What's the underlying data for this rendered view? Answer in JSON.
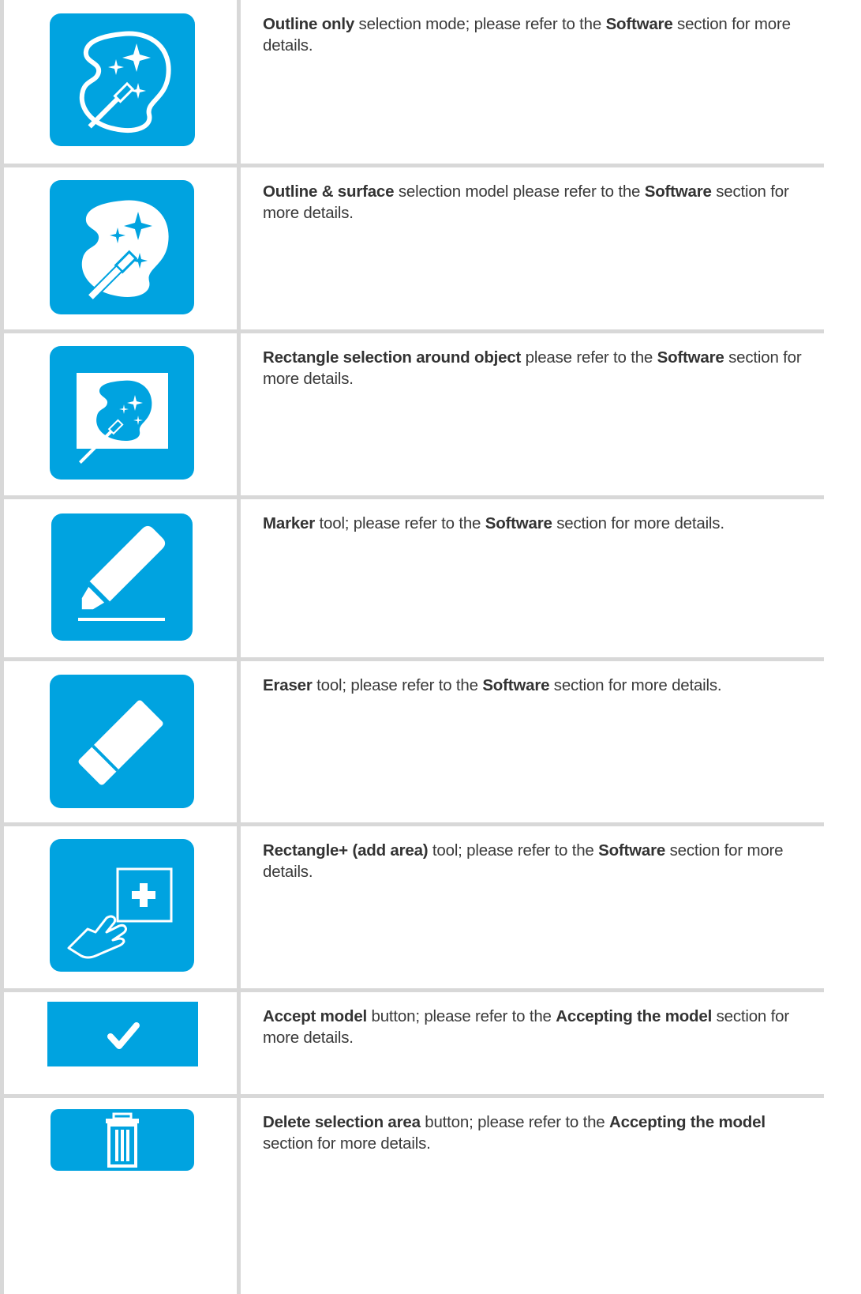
{
  "rows": [
    {
      "icon": "outline-only-magic-wand-icon",
      "parts": [
        {
          "t": "Outline only",
          "b": true
        },
        {
          "t": " selection mode; please refer to the ",
          "b": false
        },
        {
          "t": "Software",
          "b": true
        },
        {
          "t": " section for more details.",
          "b": false
        }
      ]
    },
    {
      "icon": "outline-and-surface-magic-wand-icon",
      "parts": [
        {
          "t": "Outline & surface",
          "b": true
        },
        {
          "t": " selection model please refer to the ",
          "b": false
        },
        {
          "t": "Software",
          "b": true
        },
        {
          "t": " section for more details.",
          "b": false
        }
      ]
    },
    {
      "icon": "rectangle-selection-icon",
      "parts": [
        {
          "t": "Rectangle selection around object",
          "b": true
        },
        {
          "t": " please refer to the ",
          "b": false
        },
        {
          "t": "Software",
          "b": true
        },
        {
          "t": " section for more details.",
          "b": false
        }
      ]
    },
    {
      "icon": "marker-icon",
      "parts": [
        {
          "t": "Marker",
          "b": true
        },
        {
          "t": " tool; please refer to the ",
          "b": false
        },
        {
          "t": "Software",
          "b": true
        },
        {
          "t": " section for more details.",
          "b": false
        }
      ]
    },
    {
      "icon": "eraser-icon",
      "parts": [
        {
          "t": "Eraser",
          "b": true
        },
        {
          "t": " tool; please refer to the ",
          "b": false
        },
        {
          "t": "Software",
          "b": true
        },
        {
          "t": " section for more details.",
          "b": false
        }
      ]
    },
    {
      "icon": "rectangle-plus-icon",
      "parts": [
        {
          "t": "Rectangle+ (add area)",
          "b": true
        },
        {
          "t": " tool; please refer to the ",
          "b": false
        },
        {
          "t": "Software",
          "b": true
        },
        {
          "t": " section for more details.",
          "b": false
        }
      ]
    },
    {
      "icon": "checkmark-icon",
      "parts": [
        {
          "t": "Accept model",
          "b": true
        },
        {
          "t": " button; please refer to the ",
          "b": false
        },
        {
          "t": "Accepting the model",
          "b": true
        },
        {
          "t": " section for more details.",
          "b": false
        }
      ]
    },
    {
      "icon": "trash-icon",
      "parts": [
        {
          "t": "Delete selection area",
          "b": true
        },
        {
          "t": " button; please refer to the ",
          "b": false
        },
        {
          "t": "Accepting the model",
          "b": true
        },
        {
          "t": " section for more details.",
          "b": false
        }
      ]
    }
  ],
  "colors": {
    "icon_bg": "#00a3e0",
    "rule": "#d8d8d8",
    "text": "#3a3a3a"
  }
}
